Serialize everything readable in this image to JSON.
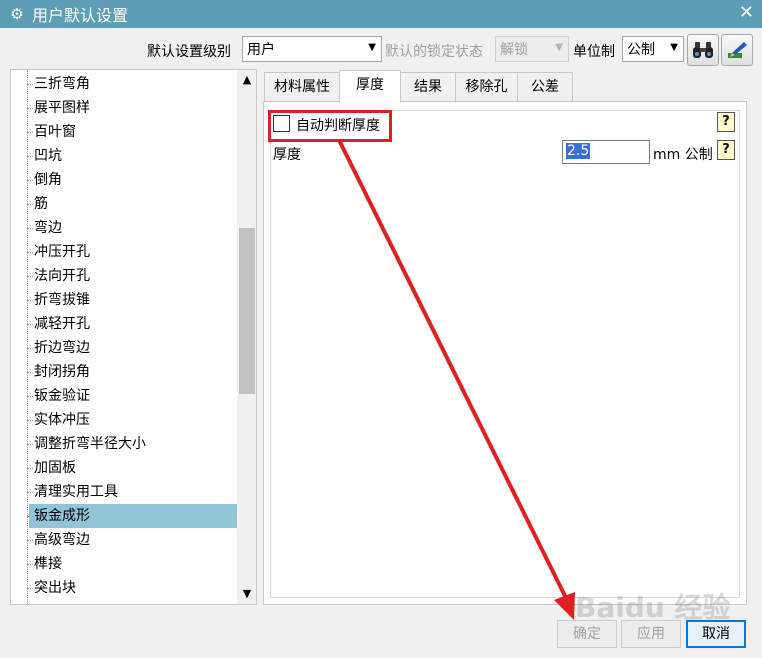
{
  "window": {
    "title": "用户默认设置",
    "title_icon": "gear-icon",
    "close_glyph": "✕"
  },
  "toolbar": {
    "level_label": "默认设置级别",
    "level_value": "用户",
    "lock_label": "默认的锁定状态",
    "lock_value": "解锁",
    "unit_label": "单位制",
    "unit_value": "公制",
    "search_icon": "binoculars-icon",
    "tool_icon": "pen-icon"
  },
  "tree": {
    "items": [
      "三折弯角",
      "展平图样",
      "百叶窗",
      "凹坑",
      "倒角",
      "筋",
      "弯边",
      "冲压开孔",
      "法向开孔",
      "折弯拔锥",
      "减轻开孔",
      "折边弯边",
      "封闭拐角",
      "钣金验证",
      "实体冲压",
      "调整折弯半径大小",
      "加固板",
      "清理实用工具",
      "钣金成形",
      "高级弯边",
      "榫接",
      "突出块"
    ],
    "selected_index": 18
  },
  "tabs": [
    "材料属性",
    "厚度",
    "结果",
    "移除孔",
    "公差"
  ],
  "active_tab": 1,
  "panel": {
    "auto_thickness_label": "自动判断厚度",
    "auto_thickness_checked": false,
    "thickness_label": "厚度",
    "thickness_value": "2.5",
    "thickness_unit": "mm 公制",
    "help_glyph": "?"
  },
  "buttons": {
    "ok": "确定",
    "apply": "应用",
    "cancel": "取消"
  },
  "colors": {
    "titlebar": "#5c9eb6",
    "selected_row": "#91c4d6",
    "annotation": "#e02020",
    "input_selection": "#3470d8"
  },
  "watermark": "Baidu 经验"
}
